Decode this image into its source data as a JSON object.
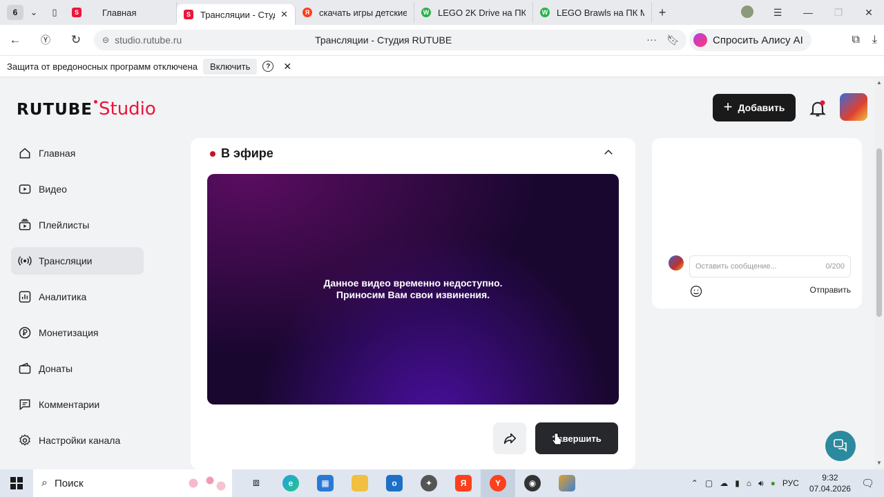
{
  "browser": {
    "tab_count": "6",
    "tabs": [
      {
        "label": "Главная"
      },
      {
        "label": "Трансляции - Студ"
      },
      {
        "label": "скачать игры детские"
      },
      {
        "label": "LEGO 2K Drive на ПК"
      },
      {
        "label": "LEGO Brawls на ПК М"
      }
    ],
    "url": "studio.rutube.ru",
    "page_title": "Трансляции - Студия RUTUBE",
    "alice_label": "Спросить Алису AI"
  },
  "infobar": {
    "message": "Защита от вредоносных программ отключена",
    "enable_label": "Включить",
    "help": "?"
  },
  "header": {
    "logo_main": "RUTUBE",
    "logo_accent": "Studio",
    "add_label": "Добавить"
  },
  "sidebar": {
    "items": [
      {
        "label": "Главная",
        "icon": "home-icon"
      },
      {
        "label": "Видео",
        "icon": "video-icon"
      },
      {
        "label": "Плейлисты",
        "icon": "playlist-icon"
      },
      {
        "label": "Трансляции",
        "icon": "broadcast-icon",
        "active": true
      },
      {
        "label": "Аналитика",
        "icon": "analytics-icon"
      },
      {
        "label": "Монетизация",
        "icon": "ruble-icon"
      },
      {
        "label": "Донаты",
        "icon": "wallet-icon"
      },
      {
        "label": "Комментарии",
        "icon": "comment-icon"
      },
      {
        "label": "Настройки канала",
        "icon": "gear-icon"
      }
    ]
  },
  "stream": {
    "status": "В эфире",
    "video_message_1": "Данное видео временно недоступно.",
    "video_message_2": "Приносим Вам свои извинения.",
    "finish_label": "Завершить"
  },
  "chat": {
    "placeholder": "Оставить сообщение...",
    "counter": "0/200",
    "send_label": "Отправить"
  },
  "taskbar": {
    "search_label": "Поиск",
    "lang": "РУС",
    "time": "9:32",
    "date": "07.04.2026"
  },
  "colors": {
    "brand_red": "#ed143b",
    "dark_button": "#1a1a1a",
    "help_teal": "#2b8a9e"
  }
}
